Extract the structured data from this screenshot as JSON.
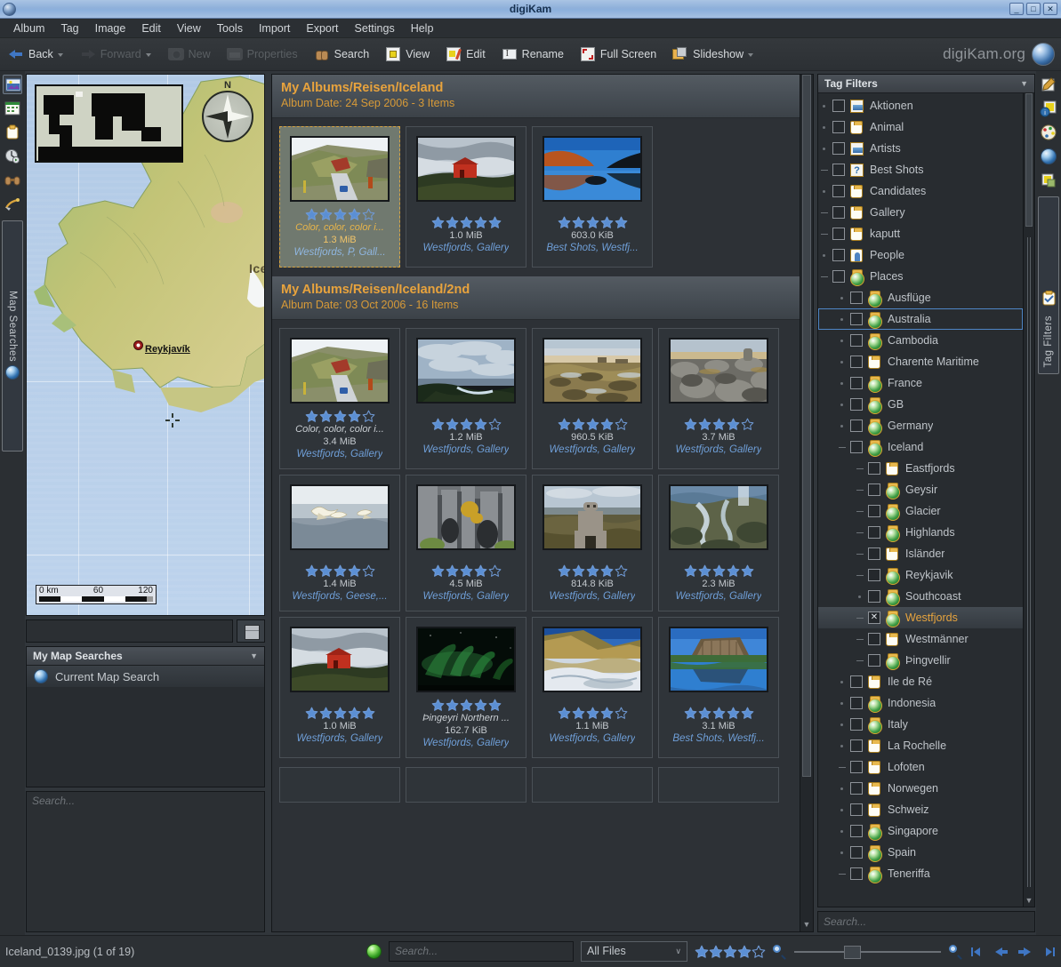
{
  "window": {
    "title": "digiKam",
    "minimize": "_",
    "maximize": "□",
    "close": "✕"
  },
  "menubar": {
    "items": [
      "Album",
      "Tag",
      "Image",
      "Edit",
      "View",
      "Tools",
      "Import",
      "Export",
      "Settings",
      "Help"
    ]
  },
  "toolbar": {
    "items": [
      {
        "label": "Back",
        "icon": "back-arrow-icon",
        "enabled": true,
        "has_menu": true
      },
      {
        "label": "Forward",
        "icon": "forward-arrow-icon",
        "enabled": false,
        "has_menu": true
      },
      {
        "label": "New",
        "icon": "new-album-icon",
        "enabled": false,
        "has_menu": false
      },
      {
        "label": "Properties",
        "icon": "properties-icon",
        "enabled": false,
        "has_menu": false
      },
      {
        "label": "Search",
        "icon": "binoculars-icon",
        "enabled": true,
        "has_menu": false
      },
      {
        "label": "View",
        "icon": "view-image-icon",
        "enabled": true,
        "has_menu": false
      },
      {
        "label": "Edit",
        "icon": "edit-image-icon",
        "enabled": true,
        "has_menu": false
      },
      {
        "label": "Rename",
        "icon": "rename-icon",
        "enabled": true,
        "has_menu": false
      },
      {
        "label": "Full Screen",
        "icon": "fullscreen-icon",
        "enabled": true,
        "has_menu": false
      },
      {
        "label": "Slideshow",
        "icon": "slideshow-icon",
        "enabled": true,
        "has_menu": true
      }
    ],
    "brand": "digiKam.org"
  },
  "left_sidebar": {
    "icons": [
      "albums-icon",
      "calendar-icon",
      "tags-icon",
      "timeline-icon",
      "searches-icon",
      "fuzzy-search-icon"
    ],
    "active_tab": "Map Searches",
    "active_tab_icon": "globe-icon"
  },
  "map": {
    "overview_name": "world-overview-map",
    "compass_north": "N",
    "city_label": "Reykjavík",
    "country_label": "Icelan",
    "scale": {
      "start": "0 km",
      "mid": "60",
      "end": "120"
    }
  },
  "map_search": {
    "input_value": "",
    "save_button_icon": "save-icon",
    "panel_title": "My Map Searches",
    "items": [
      {
        "label": "Current Map Search",
        "icon": "globe-icon"
      }
    ],
    "bottom_search_placeholder": "Search..."
  },
  "albums": [
    {
      "title": "My Albums/Reisen/Iceland",
      "subtitle": "Album Date: 24 Sep 2006 - 3 Items",
      "items": [
        {
          "caption": "Color, color, color i...",
          "size": "1.3 MiB",
          "tags": "Westfjords, P, Gall...",
          "rating": 4,
          "selected": true,
          "thumb": "road-through-colorful-hills"
        },
        {
          "caption": "",
          "size": "1.0 MiB",
          "tags": "Westfjords, Gallery",
          "rating": 5,
          "selected": false,
          "thumb": "red-hut-on-green-hill"
        },
        {
          "caption": "",
          "size": "603.0 KiB",
          "tags": "Best Shots, Westfj...",
          "rating": 5,
          "selected": false,
          "thumb": "blue-fjord-reflection"
        }
      ]
    },
    {
      "title": "My Albums/Reisen/Iceland/2nd",
      "subtitle": "Album Date: 03 Oct 2006 - 16 Items",
      "items": [
        {
          "caption": "Color, color, color i...",
          "size": "3.4 MiB",
          "tags": "Westfjords, Gallery",
          "rating": 4,
          "selected": false,
          "thumb": "road-through-colorful-hills"
        },
        {
          "caption": "",
          "size": "1.2 MiB",
          "tags": "Westfjords, Gallery",
          "rating": 4,
          "selected": false,
          "thumb": "cloudy-coast-dusk"
        },
        {
          "caption": "",
          "size": "960.5 KiB",
          "tags": "Westfjords, Gallery",
          "rating": 4,
          "selected": false,
          "thumb": "tidal-flats-rocks"
        },
        {
          "caption": "",
          "size": "3.7 MiB",
          "tags": "Westfjords, Gallery",
          "rating": 4,
          "selected": false,
          "thumb": "boulder-beach"
        },
        {
          "caption": "",
          "size": "1.4 MiB",
          "tags": "Westfjords, Geese,...",
          "rating": 4,
          "selected": false,
          "thumb": "flying-swans"
        },
        {
          "caption": "",
          "size": "4.5 MiB",
          "tags": "Westfjords, Gallery",
          "rating": 4,
          "selected": false,
          "thumb": "basalt-cliff-autumn"
        },
        {
          "caption": "",
          "size": "814.8 KiB",
          "tags": "Westfjords, Gallery",
          "rating": 4,
          "selected": false,
          "thumb": "stone-statue-tundra"
        },
        {
          "caption": "",
          "size": "2.3 MiB",
          "tags": "Westfjords, Gallery",
          "rating": 5,
          "selected": false,
          "thumb": "river-valley-aerial"
        },
        {
          "caption": "",
          "size": "1.0 MiB",
          "tags": "Westfjords, Gallery",
          "rating": 5,
          "selected": false,
          "thumb": "red-hut-on-green-hill"
        },
        {
          "caption": "Þingeyri Northern ...",
          "size": "162.7 KiB",
          "tags": "Westfjords, Gallery",
          "rating": 5,
          "selected": false,
          "thumb": "northern-lights"
        },
        {
          "caption": "",
          "size": "1.1 MiB",
          "tags": "Westfjords, Gallery",
          "rating": 4,
          "selected": false,
          "thumb": "golden-fjord-water"
        },
        {
          "caption": "",
          "size": "3.1 MiB",
          "tags": "Best Shots, Westfj...",
          "rating": 5,
          "selected": false,
          "thumb": "table-mountain-reflection"
        }
      ]
    }
  ],
  "right_sidebar": {
    "icons": [
      "properties-pencil-icon",
      "metadata-info-icon",
      "colors-icon",
      "geolocation-globe-icon",
      "captions-tags-icon"
    ],
    "active_tab": "Tag Filters",
    "active_tab_icon": "tag-filters-icon"
  },
  "tag_filters": {
    "panel_title": "Tag Filters",
    "search_placeholder": "Search...",
    "rows": [
      {
        "label": "Aktionen",
        "indent": 0,
        "icon": "picture-tag-icon",
        "expander": "dot",
        "checked": false,
        "focused": false
      },
      {
        "label": "Animal",
        "indent": 0,
        "icon": "plain-tag-icon",
        "expander": "dot",
        "checked": false,
        "focused": false
      },
      {
        "label": "Artists",
        "indent": 0,
        "icon": "picture-tag-icon",
        "expander": "dot",
        "checked": false,
        "focused": false
      },
      {
        "label": "Best Shots",
        "indent": 0,
        "icon": "question-tag-icon",
        "expander": "dash",
        "checked": false,
        "focused": false
      },
      {
        "label": "Candidates",
        "indent": 0,
        "icon": "plain-tag-icon",
        "expander": "dot",
        "checked": false,
        "focused": false
      },
      {
        "label": "Gallery",
        "indent": 0,
        "icon": "plain-tag-icon",
        "expander": "dash",
        "checked": false,
        "focused": false
      },
      {
        "label": "kaputt",
        "indent": 0,
        "icon": "plain-tag-icon",
        "expander": "dash",
        "checked": false,
        "focused": false
      },
      {
        "label": "People",
        "indent": 0,
        "icon": "person-tag-icon",
        "expander": "dot",
        "checked": false,
        "focused": false
      },
      {
        "label": "Places",
        "indent": 0,
        "icon": "globe-tag-icon",
        "expander": "dash",
        "checked": false,
        "focused": false
      },
      {
        "label": "Ausflüge",
        "indent": 1,
        "icon": "globe-tag-icon",
        "expander": "dot",
        "checked": false,
        "focused": false
      },
      {
        "label": "Australia",
        "indent": 1,
        "icon": "globe-tag-icon",
        "expander": "dot",
        "checked": false,
        "focused": true
      },
      {
        "label": "Cambodia",
        "indent": 1,
        "icon": "globe-tag-icon",
        "expander": "dot",
        "checked": false,
        "focused": false
      },
      {
        "label": "Charente Maritime",
        "indent": 1,
        "icon": "plain-tag-icon",
        "expander": "dot",
        "checked": false,
        "focused": false
      },
      {
        "label": "France",
        "indent": 1,
        "icon": "globe-tag-icon",
        "expander": "dot",
        "checked": false,
        "focused": false
      },
      {
        "label": "GB",
        "indent": 1,
        "icon": "globe-tag-icon",
        "expander": "dot",
        "checked": false,
        "focused": false
      },
      {
        "label": "Germany",
        "indent": 1,
        "icon": "globe-tag-icon",
        "expander": "dot",
        "checked": false,
        "focused": false
      },
      {
        "label": "Iceland",
        "indent": 1,
        "icon": "globe-tag-icon",
        "expander": "dash",
        "checked": false,
        "focused": false
      },
      {
        "label": "Eastfjords",
        "indent": 2,
        "icon": "plain-tag-icon",
        "expander": "dash",
        "checked": false,
        "focused": false
      },
      {
        "label": "Geysir",
        "indent": 2,
        "icon": "globe-tag-icon",
        "expander": "dash",
        "checked": false,
        "focused": false
      },
      {
        "label": "Glacier",
        "indent": 2,
        "icon": "globe-tag-icon",
        "expander": "dash",
        "checked": false,
        "focused": false
      },
      {
        "label": "Highlands",
        "indent": 2,
        "icon": "globe-tag-icon",
        "expander": "dash",
        "checked": false,
        "focused": false
      },
      {
        "label": "Isländer",
        "indent": 2,
        "icon": "plain-tag-icon",
        "expander": "dash",
        "checked": false,
        "focused": false
      },
      {
        "label": "Reykjavik",
        "indent": 2,
        "icon": "globe-tag-icon",
        "expander": "dash",
        "checked": false,
        "focused": false
      },
      {
        "label": "Southcoast",
        "indent": 2,
        "icon": "globe-tag-icon",
        "expander": "dot",
        "checked": false,
        "focused": false
      },
      {
        "label": "Westfjords",
        "indent": 2,
        "icon": "globe-tag-icon",
        "expander": "dash",
        "checked": true,
        "focused": false
      },
      {
        "label": "Westmänner",
        "indent": 2,
        "icon": "plain-tag-icon",
        "expander": "dash",
        "checked": false,
        "focused": false
      },
      {
        "label": "Þingvellir",
        "indent": 2,
        "icon": "globe-tag-icon",
        "expander": "dash",
        "checked": false,
        "focused": false
      },
      {
        "label": "Ile de Ré",
        "indent": 1,
        "icon": "plain-tag-icon",
        "expander": "dot",
        "checked": false,
        "focused": false
      },
      {
        "label": "Indonesia",
        "indent": 1,
        "icon": "globe-tag-icon",
        "expander": "dot",
        "checked": false,
        "focused": false
      },
      {
        "label": "Italy",
        "indent": 1,
        "icon": "globe-tag-icon",
        "expander": "dot",
        "checked": false,
        "focused": false
      },
      {
        "label": "La Rochelle",
        "indent": 1,
        "icon": "plain-tag-icon",
        "expander": "dot",
        "checked": false,
        "focused": false
      },
      {
        "label": "Lofoten",
        "indent": 1,
        "icon": "plain-tag-icon",
        "expander": "dash",
        "checked": false,
        "focused": false
      },
      {
        "label": "Norwegen",
        "indent": 1,
        "icon": "plain-tag-icon",
        "expander": "dot",
        "checked": false,
        "focused": false
      },
      {
        "label": "Schweiz",
        "indent": 1,
        "icon": "plain-tag-icon",
        "expander": "dot",
        "checked": false,
        "focused": false
      },
      {
        "label": "Singapore",
        "indent": 1,
        "icon": "globe-tag-icon",
        "expander": "dot",
        "checked": false,
        "focused": false
      },
      {
        "label": "Spain",
        "indent": 1,
        "icon": "globe-tag-icon",
        "expander": "dot",
        "checked": false,
        "focused": false
      },
      {
        "label": "Teneriffa",
        "indent": 1,
        "icon": "globe-tag-icon",
        "expander": "dash",
        "checked": false,
        "focused": false
      }
    ]
  },
  "statusbar": {
    "file_info": "Iceland_0139.jpg (1 of 19)",
    "progress_led": "green",
    "search_placeholder": "Search...",
    "filter_value": "All Files",
    "rating_filter": 4,
    "rating_max": 5,
    "zoom_out_icon": "zoom-out-icon",
    "zoom_in_icon": "zoom-in-icon",
    "nav": [
      "first-image-icon",
      "previous-image-icon",
      "next-image-icon",
      "last-image-icon"
    ]
  },
  "colors": {
    "accent_orange": "#e8a33d",
    "tag_link_blue": "#6f9fd8",
    "star_blue": "#5b8fd4",
    "selection_bg": "#70796f",
    "panel_bg": "#31363b"
  }
}
